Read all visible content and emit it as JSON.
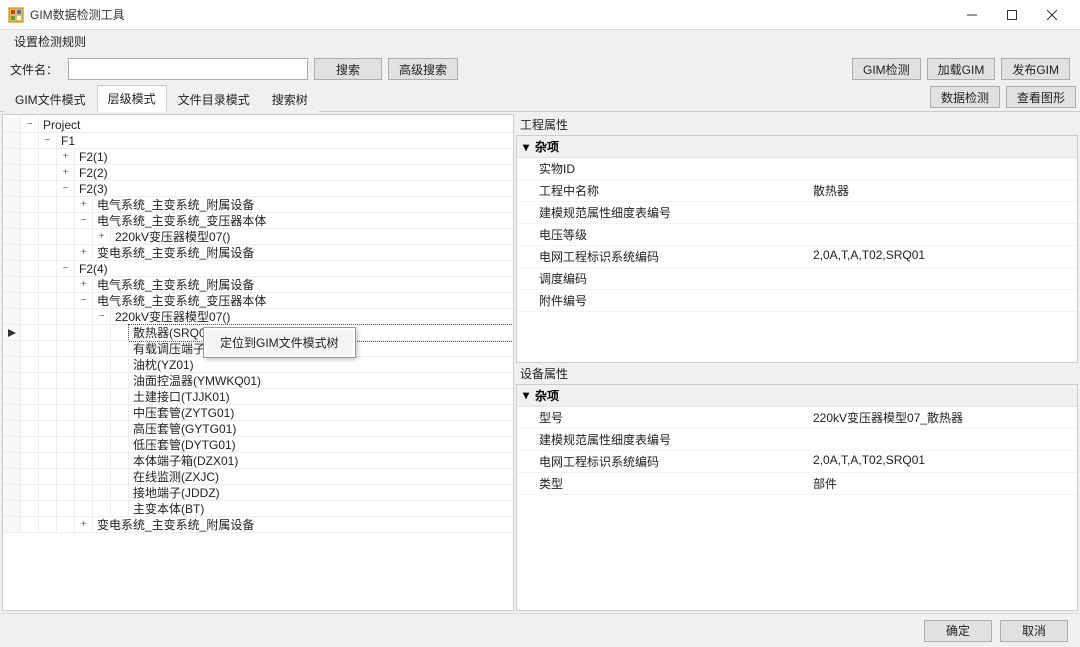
{
  "window": {
    "title": "GIM数据检测工具"
  },
  "menu": {
    "rules": "设置检测规则"
  },
  "toolbar": {
    "filename_label": "文件名：",
    "search": "搜索",
    "adv_search": "高级搜索",
    "gim_detect": "GIM检测",
    "load_gim": "加载GIM",
    "publish_gim": "发布GIM"
  },
  "tabs": {
    "items": [
      "GIM文件模式",
      "层级模式",
      "文件目录模式",
      "搜索树"
    ],
    "active_index": 1,
    "right_buttons": {
      "data_detect": "数据检测",
      "view_graph": "查看图形"
    }
  },
  "tree": {
    "rows": [
      {
        "depth": 0,
        "exp": "-",
        "label": "Project"
      },
      {
        "depth": 1,
        "exp": "-",
        "label": "F1"
      },
      {
        "depth": 2,
        "exp": "+",
        "label": "F2(1)"
      },
      {
        "depth": 2,
        "exp": "+",
        "label": "F2(2)"
      },
      {
        "depth": 2,
        "exp": "-",
        "label": "F2(3)"
      },
      {
        "depth": 3,
        "exp": "+",
        "label": "电气系统_主变系统_附属设备"
      },
      {
        "depth": 3,
        "exp": "-",
        "label": "电气系统_主变系统_变压器本体"
      },
      {
        "depth": 4,
        "exp": "+",
        "label": "220kV变压器模型07()"
      },
      {
        "depth": 3,
        "exp": "+",
        "label": "变电系统_主变系统_附属设备"
      },
      {
        "depth": 2,
        "exp": "-",
        "label": "F2(4)"
      },
      {
        "depth": 3,
        "exp": "+",
        "label": "电气系统_主变系统_附属设备"
      },
      {
        "depth": 3,
        "exp": "-",
        "label": "电气系统_主变系统_变压器本体"
      },
      {
        "depth": 4,
        "exp": "-",
        "label": "220kV变压器模型07()"
      },
      {
        "depth": 5,
        "exp": "",
        "label": "散热器(SRQ01)",
        "selected": true,
        "marker": true
      },
      {
        "depth": 5,
        "exp": "",
        "label": "有载调压端子"
      },
      {
        "depth": 5,
        "exp": "",
        "label": "油枕(YZ01)"
      },
      {
        "depth": 5,
        "exp": "",
        "label": "油面控温器(YMWKQ01)"
      },
      {
        "depth": 5,
        "exp": "",
        "label": "土建接口(TJJK01)"
      },
      {
        "depth": 5,
        "exp": "",
        "label": "中压套管(ZYTG01)"
      },
      {
        "depth": 5,
        "exp": "",
        "label": "高压套管(GYTG01)"
      },
      {
        "depth": 5,
        "exp": "",
        "label": "低压套管(DYTG01)"
      },
      {
        "depth": 5,
        "exp": "",
        "label": "本体端子箱(DZX01)"
      },
      {
        "depth": 5,
        "exp": "",
        "label": "在线监测(ZXJC)"
      },
      {
        "depth": 5,
        "exp": "",
        "label": "接地端子(JDDZ)"
      },
      {
        "depth": 5,
        "exp": "",
        "label": "主变本体(BT)"
      },
      {
        "depth": 3,
        "exp": "+",
        "label": "变电系统_主变系统_附属设备"
      }
    ]
  },
  "context_menu": {
    "locate": "定位到GIM文件模式树"
  },
  "project_props": {
    "title": "工程属性",
    "category": "杂项",
    "rows": [
      {
        "name": "实物ID",
        "value": ""
      },
      {
        "name": "工程中名称",
        "value": "散热器"
      },
      {
        "name": "建模规范属性细度表编号",
        "value": ""
      },
      {
        "name": "电压等级",
        "value": ""
      },
      {
        "name": "电网工程标识系统编码",
        "value": "2,0A,T,A,T02,SRQ01"
      },
      {
        "name": "调度编码",
        "value": ""
      },
      {
        "name": "附件编号",
        "value": ""
      }
    ]
  },
  "device_props": {
    "title": "设备属性",
    "category": "杂项",
    "rows": [
      {
        "name": "型号",
        "value": "220kV变压器模型07_散热器"
      },
      {
        "name": "建模规范属性细度表编号",
        "value": ""
      },
      {
        "name": "电网工程标识系统编码",
        "value": "2,0A,T,A,T02,SRQ01"
      },
      {
        "name": "类型",
        "value": "部件"
      }
    ]
  },
  "footer": {
    "ok": "确定",
    "cancel": "取消"
  }
}
